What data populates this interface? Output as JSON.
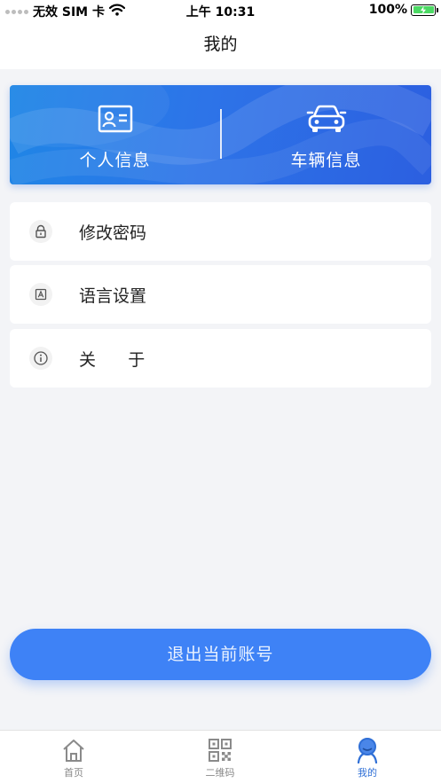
{
  "status_bar": {
    "carrier": "无效 SIM 卡",
    "time": "上午 10:31",
    "battery": "100%"
  },
  "nav": {
    "title": "我的"
  },
  "banner": {
    "items": [
      {
        "label": "个人信息",
        "icon": "id-card-icon"
      },
      {
        "label": "车辆信息",
        "icon": "car-icon"
      }
    ]
  },
  "menu": {
    "items": [
      {
        "label": "修改密码",
        "icon": "lock-icon"
      },
      {
        "label": "语言设置",
        "icon": "language-icon"
      },
      {
        "label": "关      于",
        "icon": "info-icon"
      }
    ]
  },
  "logout": {
    "label": "退出当前账号"
  },
  "tabs": {
    "items": [
      {
        "label": "首页",
        "icon": "home-icon"
      },
      {
        "label": "二维码",
        "icon": "qr-code-icon"
      },
      {
        "label": "我的",
        "icon": "profile-icon",
        "active": true
      }
    ]
  },
  "colors": {
    "accent": "#3e82f6",
    "banner_start": "#1f86e6",
    "banner_end": "#2c5fe0",
    "active_tab": "#2f6fd6",
    "background": "#f3f4f7",
    "battery_fill": "#4cd964"
  }
}
